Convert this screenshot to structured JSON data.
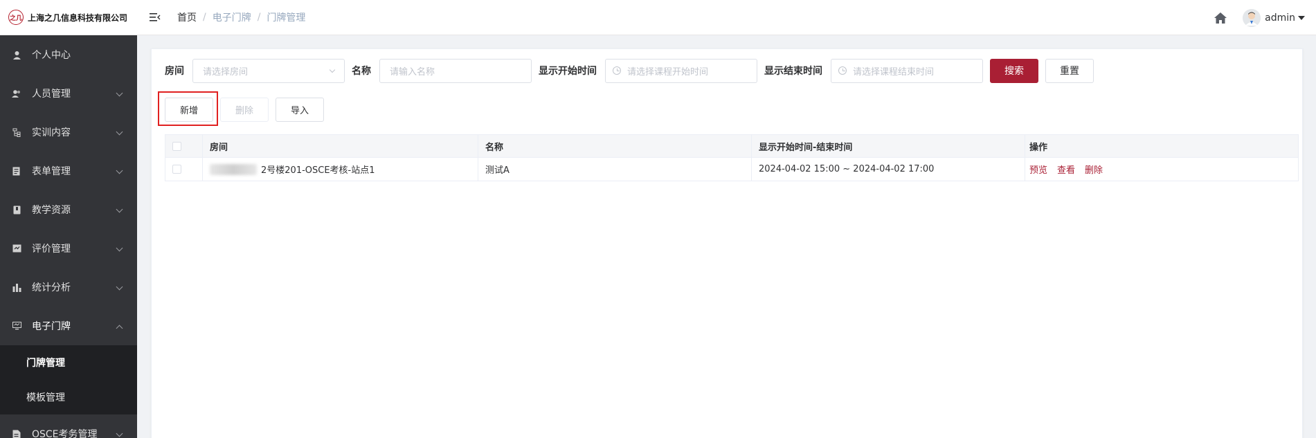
{
  "header": {
    "logo_text": "之几",
    "company_name": "上海之几信息科技有限公司",
    "breadcrumb": [
      "首页",
      "电子门牌",
      "门牌管理"
    ],
    "username": "admin"
  },
  "sidebar": {
    "items": [
      {
        "label": "个人中心",
        "icon": "user-icon"
      },
      {
        "label": "人员管理",
        "icon": "users-icon"
      },
      {
        "label": "实训内容",
        "icon": "tree-icon"
      },
      {
        "label": "表单管理",
        "icon": "form-icon"
      },
      {
        "label": "教学资源",
        "icon": "book-icon"
      },
      {
        "label": "评价管理",
        "icon": "evaluation-icon"
      },
      {
        "label": "统计分析",
        "icon": "bar-chart-icon"
      },
      {
        "label": "电子门牌",
        "icon": "monitor-icon"
      }
    ],
    "submenu": [
      {
        "label": "门牌管理"
      },
      {
        "label": "模板管理"
      }
    ],
    "after_item": {
      "label": "OSCE考务管理",
      "icon": "document-icon"
    }
  },
  "search": {
    "room_label": "房间",
    "room_placeholder": "请选择房间",
    "name_label": "名称",
    "name_placeholder": "请输入名称",
    "start_label": "显示开始时间",
    "start_placeholder": "请选择课程开始时间",
    "end_label": "显示结束时间",
    "end_placeholder": "请选择课程结束时间",
    "search_btn": "搜索",
    "reset_btn": "重置"
  },
  "actions": {
    "add": "新增",
    "delete": "删除",
    "import": "导入"
  },
  "table": {
    "columns": [
      "房间",
      "名称",
      "显示开始时间-结束时间",
      "操作"
    ],
    "rows": [
      {
        "room": "2号楼201-OSCE考核-站点1",
        "name": "测试A",
        "time": "2024-04-02 15:00 ~ 2024-04-02 17:00",
        "ops": [
          "预览",
          "查看",
          "删除"
        ]
      }
    ]
  },
  "colors": {
    "primary": "#a91f34",
    "sidebar_bg": "#333438",
    "highlight": "#e02020"
  }
}
